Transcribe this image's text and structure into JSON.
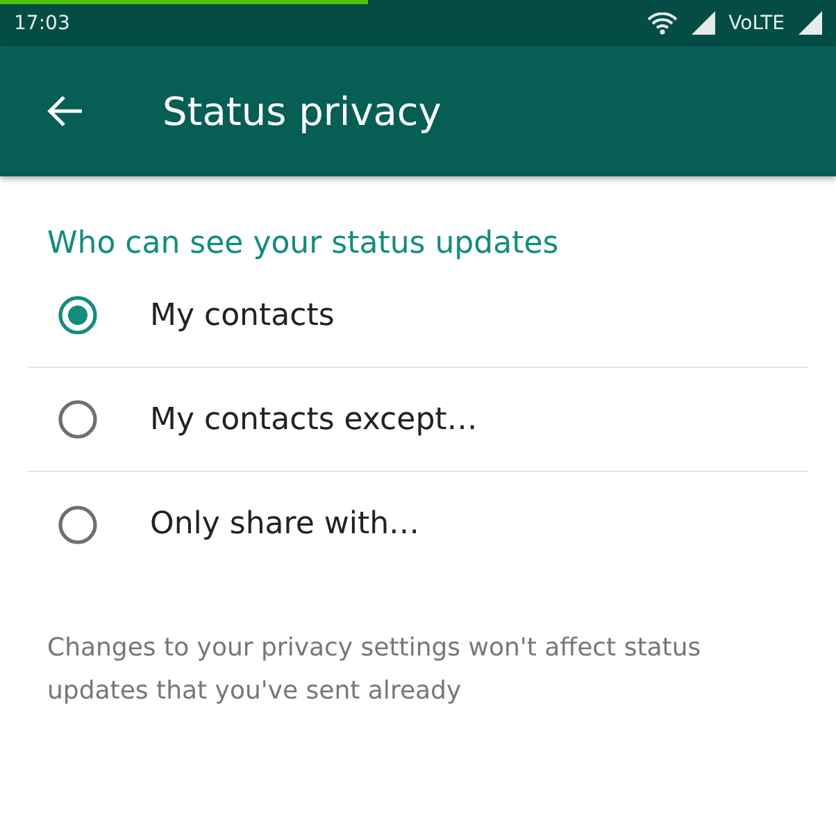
{
  "status_bar": {
    "time": "17:03",
    "network": "VoLTE",
    "progress": {
      "level": 0.44
    }
  },
  "app_bar": {
    "title": "Status privacy"
  },
  "section": {
    "heading": "Who can see your status updates",
    "options": [
      {
        "label": "My contacts",
        "selected": true
      },
      {
        "label": "My contacts except…",
        "selected": false
      },
      {
        "label": "Only share with…",
        "selected": false
      }
    ]
  },
  "footer_note": "Changes to your privacy settings won't affect status updates that you've sent already"
}
